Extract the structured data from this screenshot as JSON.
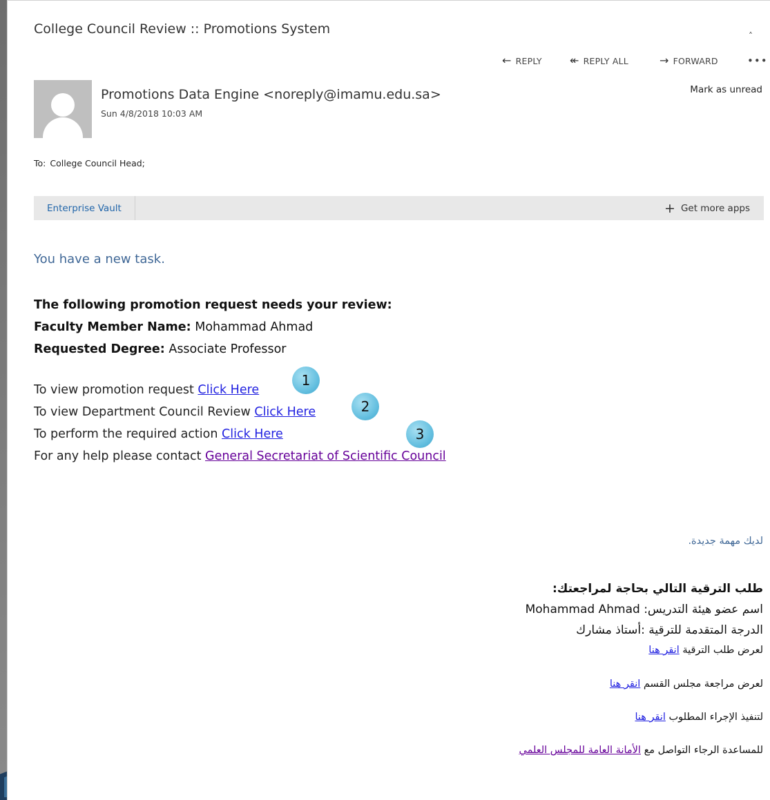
{
  "subject": "College Council Review :: Promotions System",
  "actions": {
    "reply": "REPLY",
    "reply_all": "REPLY ALL",
    "forward": "FORWARD"
  },
  "header": {
    "sender": "Promotions Data Engine <noreply@imamu.edu.sa>",
    "date": "Sun 4/8/2018 10:03 AM",
    "mark_unread": "Mark as unread",
    "to_label": "To:",
    "to_value": "College Council Head;"
  },
  "apps_bar": {
    "enterprise_vault": "Enterprise Vault",
    "get_more_apps": "Get more apps"
  },
  "body_en": {
    "new_task": "You have a new task.",
    "review_heading": "The following promotion request needs your review:",
    "faculty_label": "Faculty Member Name:",
    "faculty_value": "Mohammad Ahmad",
    "degree_label": "Requested Degree:",
    "degree_value": "Associate Professor",
    "view_request_text": "To view promotion request",
    "view_request_link": "Click Here",
    "view_dept_text": "To view Department Council Review",
    "view_dept_link": "Click Here",
    "perform_text": "To perform the required action",
    "perform_link": "Click Here",
    "help_text": "For any help please contact",
    "help_link": "General Secretariat of Scientific Council"
  },
  "badges": [
    "1",
    "2",
    "3"
  ],
  "body_ar": {
    "new_task": "لديك مهمة جديدة.",
    "review_heading": "طلب الترقية التالي بحاجة لمراجعتك:",
    "faculty_label": "اسم عضو هيئة التدريس:",
    "faculty_value": "Mohammad Ahmad",
    "degree_label": "الدرجة المتقدمة للترقية :",
    "degree_value": "أستاذ مشارك",
    "view_request_text": "لعرض طلب الترقية",
    "view_request_link": "انقر هنا",
    "view_dept_text": "لعرض مراجعة مجلس القسم",
    "view_dept_link": "انقر هنا",
    "perform_text": "لتنفيذ الإجراء المطلوب",
    "perform_link": "انقر هنا",
    "help_text": "للمساعدة الرجاء التواصل مع",
    "help_link": "الأمانة العامة للمجلس العلمي"
  }
}
